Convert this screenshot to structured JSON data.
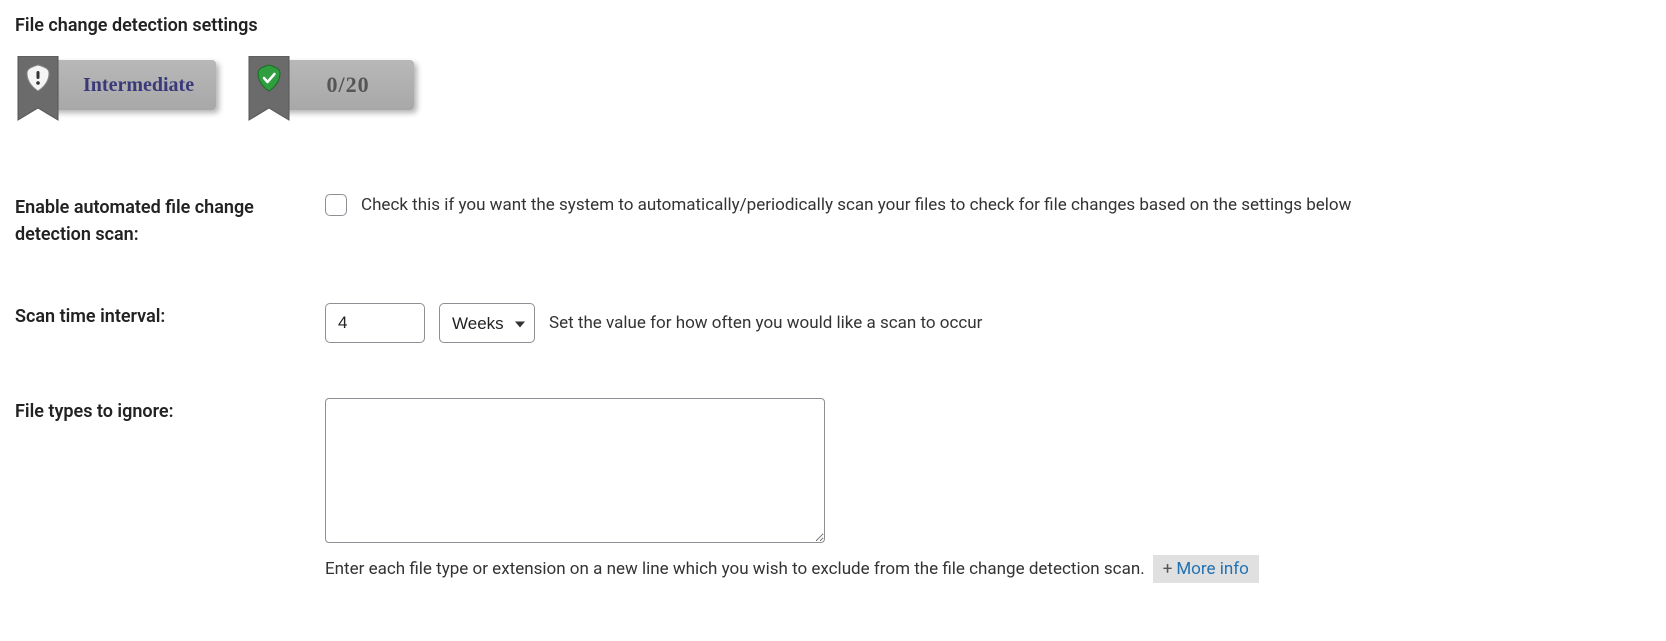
{
  "section": {
    "title": "File change detection settings"
  },
  "badges": {
    "level": "Intermediate",
    "score": "0/20"
  },
  "fields": {
    "enable_scan": {
      "label": "Enable automated file change detection scan:",
      "help": "Check this if you want the system to automatically/periodically scan your files to check for file changes based on the settings below"
    },
    "interval": {
      "label": "Scan time interval:",
      "value": "4",
      "unit": "Weeks",
      "help": "Set the value for how often you would like a scan to occur"
    },
    "ignore_types": {
      "label": "File types to ignore:",
      "value": "",
      "help": "Enter each file type or extension on a new line which you wish to exclude from the file change detection scan.",
      "more_info": "More info"
    }
  }
}
